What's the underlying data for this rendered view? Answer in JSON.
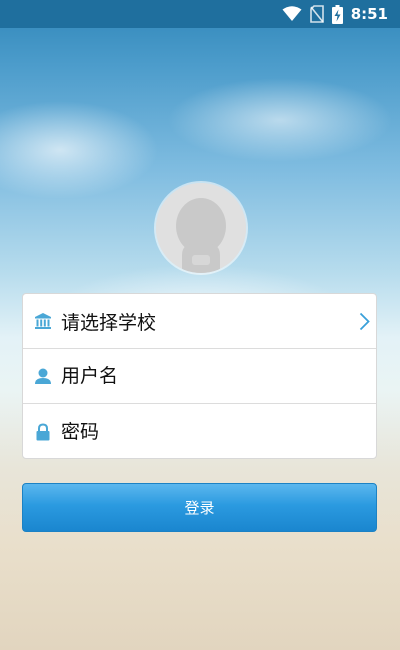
{
  "status_bar": {
    "time": "8:51",
    "icons": [
      "wifi-icon",
      "no-sim-icon",
      "battery-charging-icon"
    ]
  },
  "avatar": {
    "icon": "default-user-avatar-icon"
  },
  "form": {
    "school": {
      "label": "请选择学校",
      "icon": "school-building-icon",
      "action_icon": "chevron-right-icon"
    },
    "username": {
      "placeholder": "用户名",
      "value": "",
      "icon": "user-icon"
    },
    "password": {
      "placeholder": "密码",
      "value": "",
      "icon": "lock-icon"
    }
  },
  "login_button": {
    "label": "登录"
  },
  "colors": {
    "status_bar": "#1f6f9e",
    "accent": "#2b9ae0",
    "icon_tint": "#4aa7d6",
    "card_border": "#d8d8d8"
  }
}
